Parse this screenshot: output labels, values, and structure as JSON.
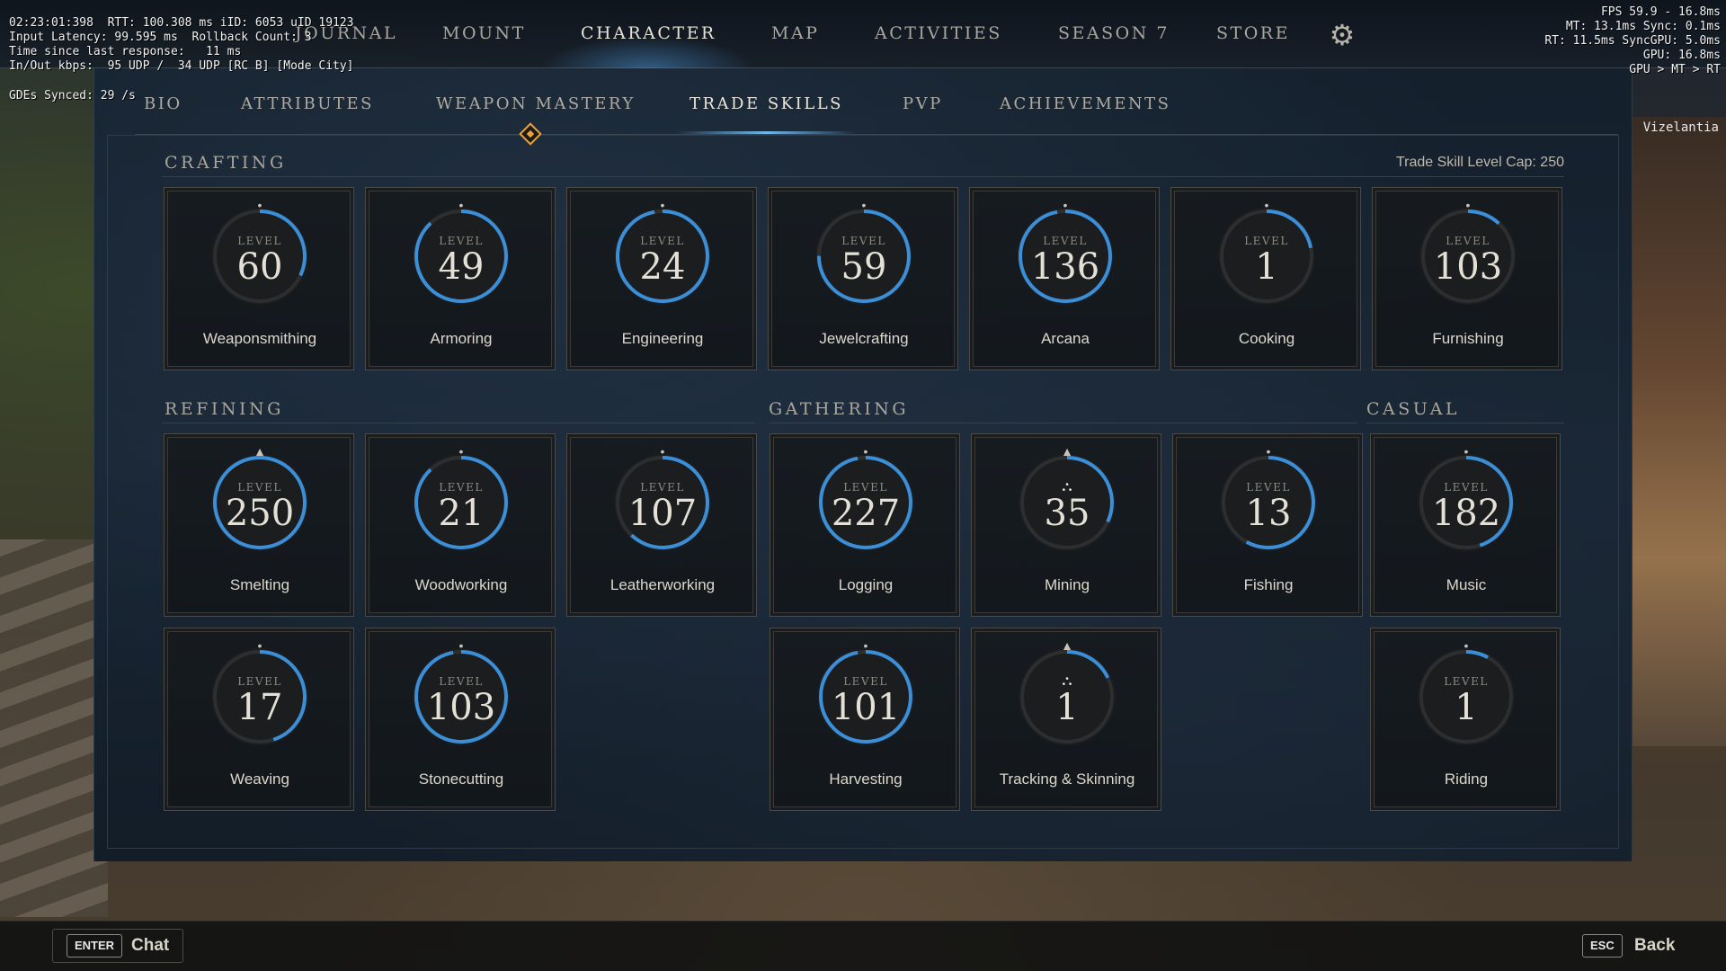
{
  "debug": {
    "left": "02:23:01:398  RTT: 100.308 ms iID: 6053 uID 19123\nInput Latency: 99.595 ms  Rollback Count: 3\nTime since last response:   11 ms\nIn/Out kbps:  95 UDP /  34 UDP [RC B] [Mode City]",
    "gde": "GDEs Synced: 29 /s",
    "right": "FPS 59.9 - 16.8ms\nMT: 13.1ms Sync: 0.1ms\nRT: 11.5ms SyncGPU: 5.0ms\nGPU: 16.8ms\nGPU > MT > RT",
    "player_name": "Vizelantia"
  },
  "topnav": {
    "items": [
      {
        "label": "JOURNAL"
      },
      {
        "label": "MOUNT"
      },
      {
        "label": "CHARACTER"
      },
      {
        "label": "MAP"
      },
      {
        "label": "ACTIVITIES"
      },
      {
        "label": "SEASON 7"
      },
      {
        "label": "STORE"
      }
    ],
    "active": "CHARACTER"
  },
  "subnav": {
    "items": [
      {
        "label": "BIO"
      },
      {
        "label": "ATTRIBUTES"
      },
      {
        "label": "WEAPON MASTERY"
      },
      {
        "label": "TRADE SKILLS"
      },
      {
        "label": "PVP"
      },
      {
        "label": "ACHIEVEMENTS"
      }
    ],
    "active": "TRADE SKILLS"
  },
  "sections": {
    "crafting": "CRAFTING",
    "refining": "REFINING",
    "gathering": "GATHERING",
    "casual": "CASUAL",
    "level_cap": "Trade Skill Level Cap: 250"
  },
  "level_label": "LEVEL",
  "skills": {
    "crafting": [
      {
        "name": "Weaponsmithing",
        "level": "60",
        "progress": 0.32
      },
      {
        "name": "Armoring",
        "level": "49",
        "progress": 0.88
      },
      {
        "name": "Engineering",
        "level": "24",
        "progress": 0.97
      },
      {
        "name": "Jewelcrafting",
        "level": "59",
        "progress": 0.75
      },
      {
        "name": "Arcana",
        "level": "136",
        "progress": 0.97
      },
      {
        "name": "Cooking",
        "level": "1",
        "progress": 0.22
      },
      {
        "name": "Furnishing",
        "level": "103",
        "progress": 0.12
      }
    ],
    "refining": [
      {
        "name": "Smelting",
        "level": "250",
        "progress": 1.0,
        "emblem": false,
        "max": true
      },
      {
        "name": "Woodworking",
        "level": "21",
        "progress": 0.88
      },
      {
        "name": "Leatherworking",
        "level": "107",
        "progress": 0.62
      },
      {
        "name": "Weaving",
        "level": "17",
        "progress": 0.45
      },
      {
        "name": "Stonecutting",
        "level": "103",
        "progress": 0.97
      }
    ],
    "gathering": [
      {
        "name": "Logging",
        "level": "227",
        "progress": 0.97
      },
      {
        "name": "Mining",
        "level": "35",
        "progress": 0.32,
        "emblem": true
      },
      {
        "name": "Harvesting",
        "level": "101",
        "progress": 0.97
      },
      {
        "name": "Tracking & Skinning",
        "level": "1",
        "progress": 0.18,
        "emblem": true
      }
    ],
    "casual": [
      {
        "name": "Fishing",
        "level": "13",
        "progress": 0.58
      },
      {
        "name": "Music",
        "level": "182",
        "progress": 0.45
      },
      {
        "name": "Riding",
        "level": "1",
        "progress": 0.08
      }
    ]
  },
  "bottombar": {
    "chat_key": "ENTER",
    "chat_label": "Chat",
    "back_key": "ESC",
    "back_label": "Back"
  },
  "colors": {
    "ring_fill": "#3a8fd8",
    "ring_track": "#1a1c1e",
    "accent": "#e8a23a"
  }
}
